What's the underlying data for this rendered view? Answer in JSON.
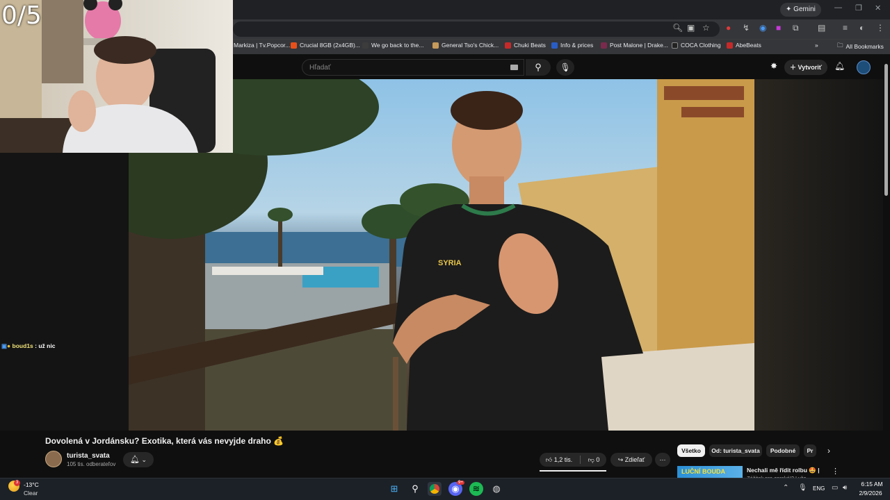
{
  "stream": {
    "counter": "0/5"
  },
  "browser": {
    "gemini_label": "Gemini",
    "bookmarks": [
      {
        "label": "Markiza | Tv.Popcor...",
        "color": "#1a1a1a"
      },
      {
        "label": "Crucial 8GB (2x4GB)...",
        "color": "#e8501a"
      },
      {
        "label": "We go back to the...",
        "color": "#3c3c3c"
      },
      {
        "label": "General Tso's Chick...",
        "color": "#c69a5b"
      },
      {
        "label": "Chuki Beats",
        "color": "#c52a2a"
      },
      {
        "label": "Info & prices",
        "color": "#2a5cc5"
      },
      {
        "label": "Post Malone | Drake...",
        "color": "#7a2a4c"
      },
      {
        "label": "COCA Clothing",
        "color": "#222222"
      },
      {
        "label": "AbeBeats",
        "color": "#c52a2a"
      }
    ],
    "all_bookmarks_label": "All Bookmarks"
  },
  "youtube": {
    "search_placeholder": "Hľadať",
    "create_label": "Vytvoriť",
    "video_title": "Dovolená v Jordánsku?⁠ Exotika, která vás nevyjde draho 💰",
    "channel_name": "turista_svata",
    "channel_subs": "105 tis. odberateľov",
    "likes": "1,2 tis.",
    "dislikes": "0",
    "share_label": "Zdieľať",
    "chips": [
      "Všetko",
      "Od: turista_svata",
      "Podobné",
      "Pr"
    ],
    "reco_title": "Nechali mě řídit rolbu 🤩 |",
    "reco_sub": "Zážitek pro zoraké!? Lyže",
    "reco_thumb_text": "LUČNÍ BOUDA"
  },
  "chat": {
    "user": "boud1s",
    "message": "už nic"
  },
  "video_overlay": {
    "shirt_text": "SYRIA"
  },
  "taskbar": {
    "temperature": "-13°C",
    "condition": "Clear",
    "weather_badge": "3",
    "lang": "ENG",
    "time": "6:15 AM",
    "date": "2/9/2026",
    "discord_badge": "9+"
  }
}
